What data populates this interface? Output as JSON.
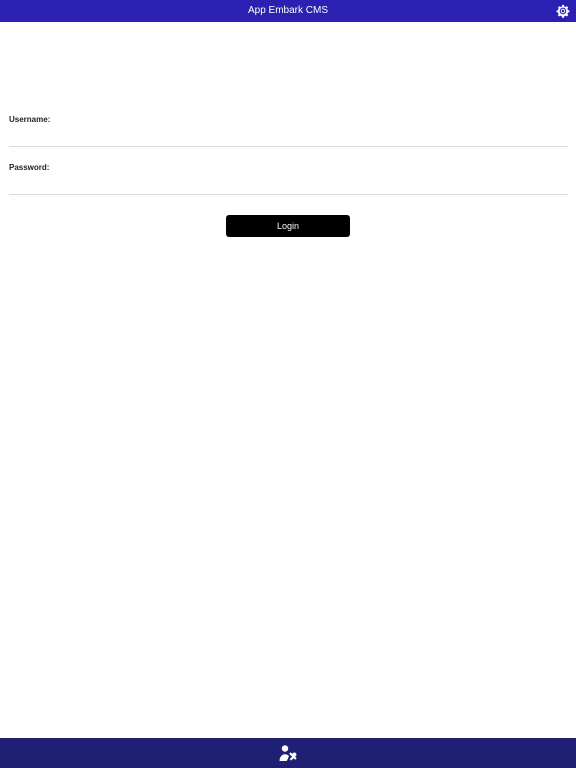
{
  "header": {
    "title": "App Embark CMS",
    "settings_icon": "gear-icon",
    "background_color": "#2a21b3"
  },
  "login_form": {
    "username_label": "Username:",
    "username_value": "",
    "password_label": "Password:",
    "password_value": "",
    "login_label": "Login"
  },
  "tabbar": {
    "active_tab_icon": "user-tools-icon",
    "background_color": "#1f1f73"
  }
}
